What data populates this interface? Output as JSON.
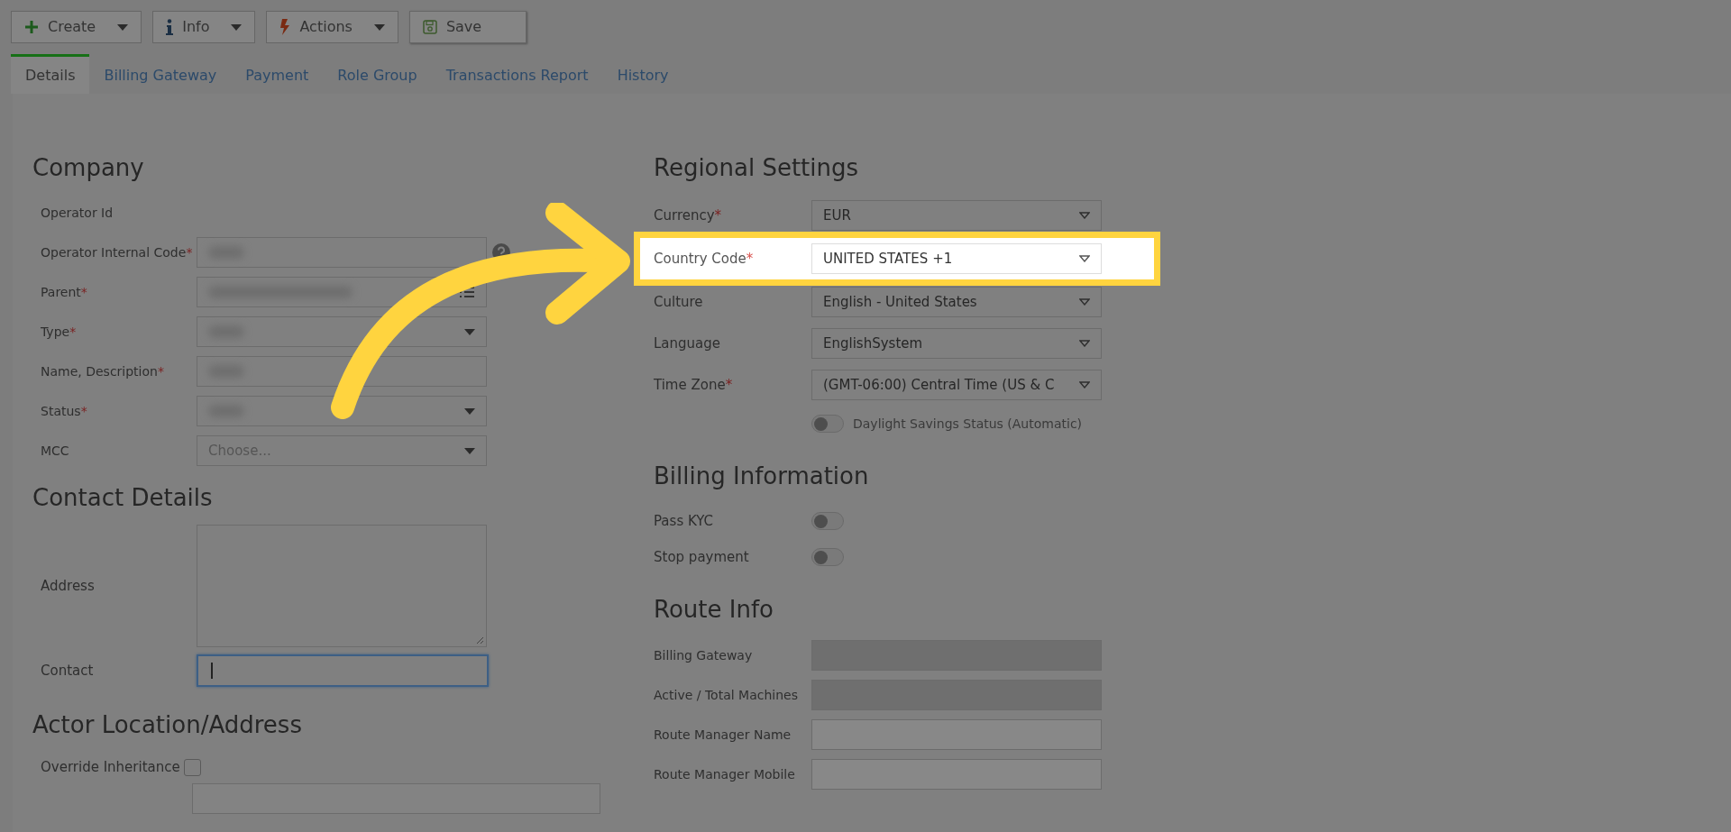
{
  "toolbar": [
    {
      "label": "Create",
      "kind": "split"
    },
    {
      "label": "Info",
      "kind": "split"
    },
    {
      "label": "Actions",
      "kind": "split"
    },
    {
      "label": "Save",
      "kind": "plain"
    }
  ],
  "tabs": [
    {
      "label": "Details",
      "selected": true
    },
    {
      "label": "Billing Gateway",
      "selected": false
    },
    {
      "label": "Payment",
      "selected": false
    },
    {
      "label": "Role Group",
      "selected": false
    },
    {
      "label": "Transactions Report",
      "selected": false
    },
    {
      "label": "History",
      "selected": false
    }
  ],
  "company": {
    "title": "Company",
    "fields": [
      {
        "label": "Operator Id",
        "kind": "none"
      },
      {
        "label": "Operator Internal Code",
        "marker": "*",
        "kind": "text",
        "blurred": true,
        "help": true
      },
      {
        "label": "Parent",
        "marker": "*",
        "kind": "lookup",
        "blurred": true
      },
      {
        "label": "Type",
        "marker": "*",
        "kind": "select",
        "blurred": true
      },
      {
        "label": "Name, Description",
        "marker": "*",
        "kind": "text",
        "blurred": true
      },
      {
        "label": "Status",
        "marker": "*",
        "kind": "select",
        "blurred": true
      },
      {
        "label": "MCC",
        "kind": "select",
        "placeholder": "Choose..."
      }
    ]
  },
  "contact": {
    "title": "Contact Details",
    "fields": [
      {
        "label": "Address",
        "kind": "textarea",
        "focused": false
      },
      {
        "label": "Contact",
        "kind": "text",
        "focused": true
      }
    ]
  },
  "location": {
    "title": "Actor Location/Address",
    "override": {
      "label": "Override Inheritance",
      "checked": false
    }
  },
  "regional": {
    "title": "Regional Settings",
    "fields": [
      {
        "label": "Currency",
        "marker": "*",
        "value": "EUR",
        "highlighted": false
      },
      {
        "label": "Country Code",
        "marker": "*",
        "value": "UNITED STATES +1",
        "highlighted": true
      },
      {
        "label": "Culture",
        "value": "English - United States",
        "highlighted": false
      },
      {
        "label": "Language",
        "value": "EnglishSystem",
        "highlighted": false
      },
      {
        "label": "Time Zone",
        "marker": "*",
        "value": "(GMT-06:00) Central Time (US & C",
        "highlighted": false
      }
    ],
    "daylight": {
      "label": "Daylight Savings Status (Automatic)",
      "on": false
    }
  },
  "billing": {
    "title": "Billing Information",
    "toggles": [
      {
        "label": "Pass KYC",
        "on": false
      },
      {
        "label": "Stop payment",
        "on": false
      }
    ]
  },
  "route": {
    "title": "Route Info",
    "fields": [
      {
        "label": "Billing Gateway",
        "disabled": true
      },
      {
        "label": "Active / Total Machines",
        "disabled": true
      },
      {
        "label": "Route Manager Name",
        "disabled": false
      },
      {
        "label": "Route Manager Mobile",
        "disabled": false
      }
    ]
  }
}
